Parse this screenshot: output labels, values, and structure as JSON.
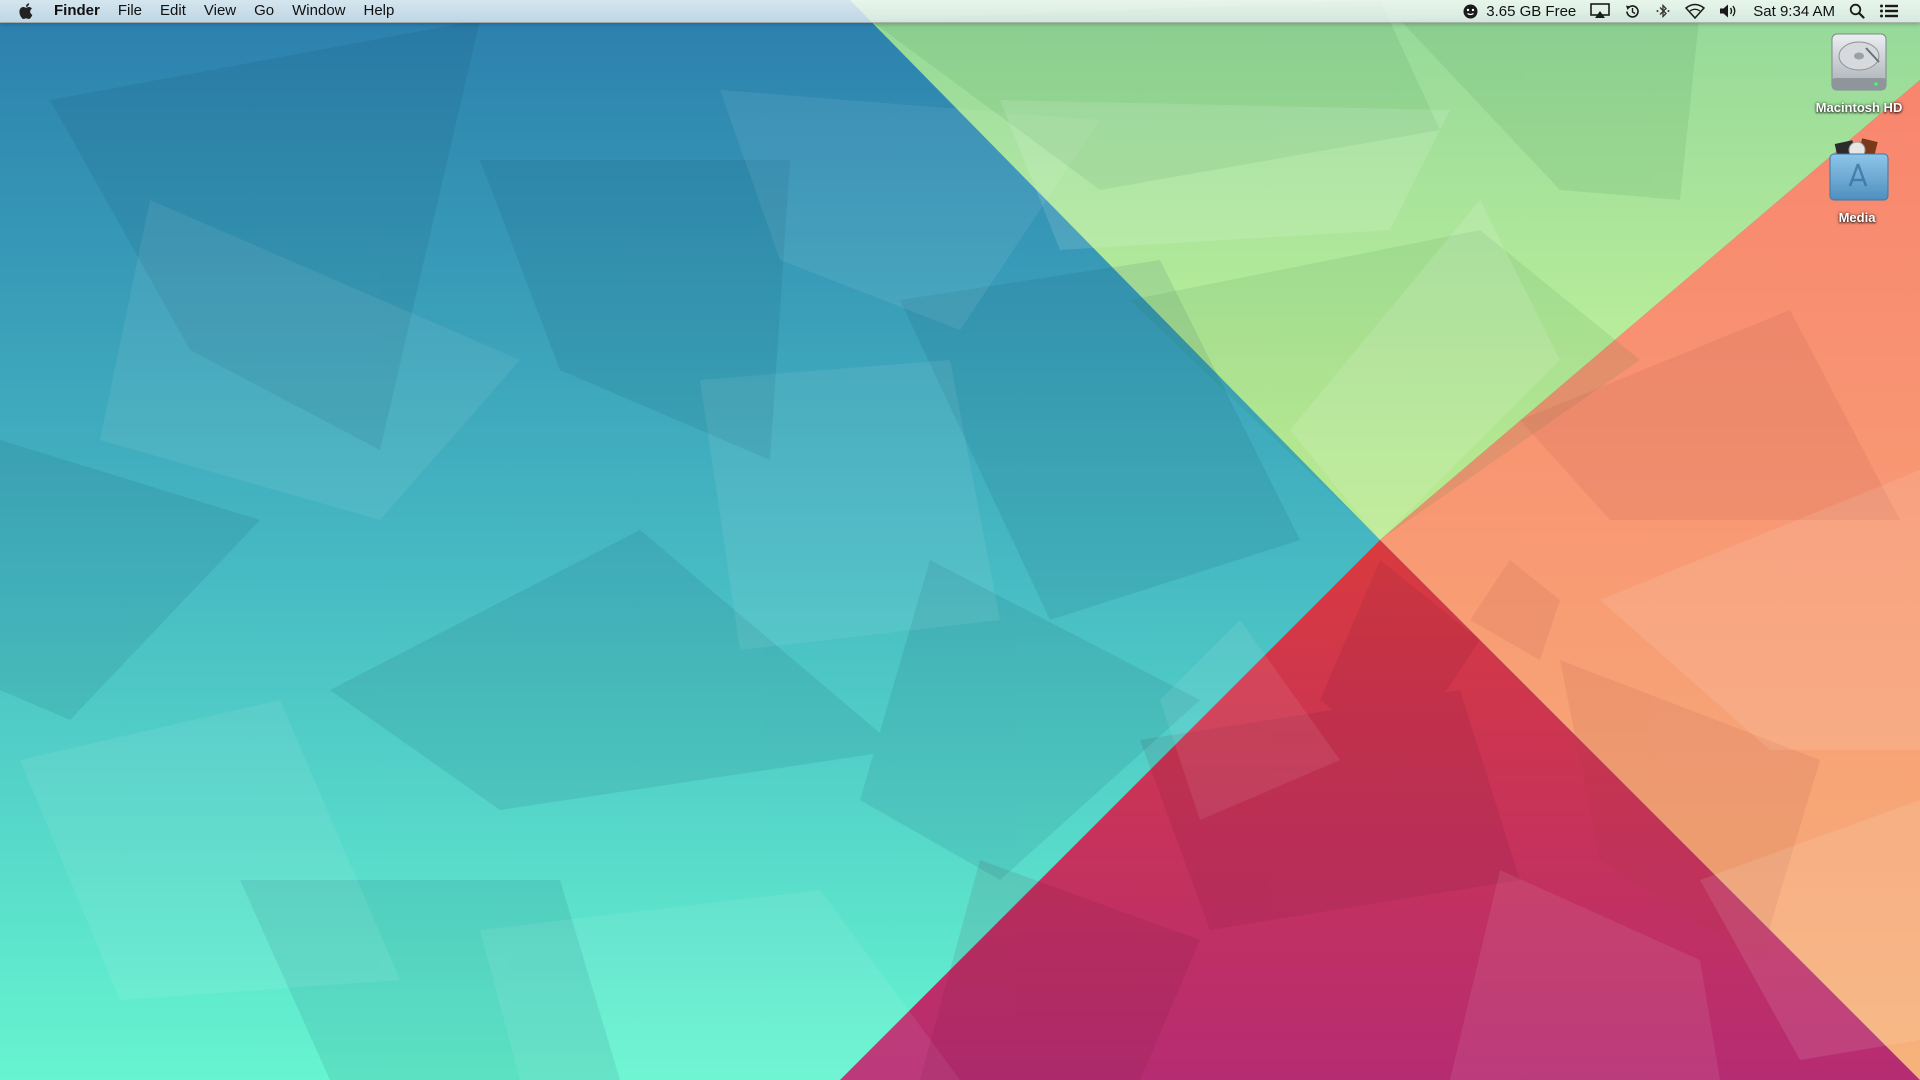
{
  "menubar": {
    "apple_icon": "apple-logo-icon",
    "app_name": "Finder",
    "menus": [
      "File",
      "Edit",
      "View",
      "Go",
      "Window",
      "Help"
    ],
    "status": {
      "disk_free": "3.65 GB Free",
      "disk_icon": "face-icon",
      "airplay_icon": "airplay-icon",
      "time_machine_icon": "time-machine-icon",
      "bluetooth_icon": "bluetooth-icon",
      "wifi_icon": "wifi-icon",
      "volume_icon": "speaker-volume-icon",
      "clock": "Sat 9:34 AM",
      "spotlight_icon": "search-icon",
      "notification_icon": "list-icon"
    }
  },
  "desktop": {
    "icons": [
      {
        "label": "Macintosh HD",
        "icon": "hard-drive-icon"
      },
      {
        "label": "Media",
        "icon": "app-folder-icon"
      }
    ]
  },
  "colors": {
    "teal_top": "#2c87b6",
    "teal_bottom": "#62f3cf",
    "green_top": "#8ed799",
    "green_center": "#cffa98",
    "red_center": "#d7363f",
    "magenta_bottom": "#bf2e6e",
    "orange_right": "#f6a37a",
    "peach_bottom": "#f8b57c"
  }
}
